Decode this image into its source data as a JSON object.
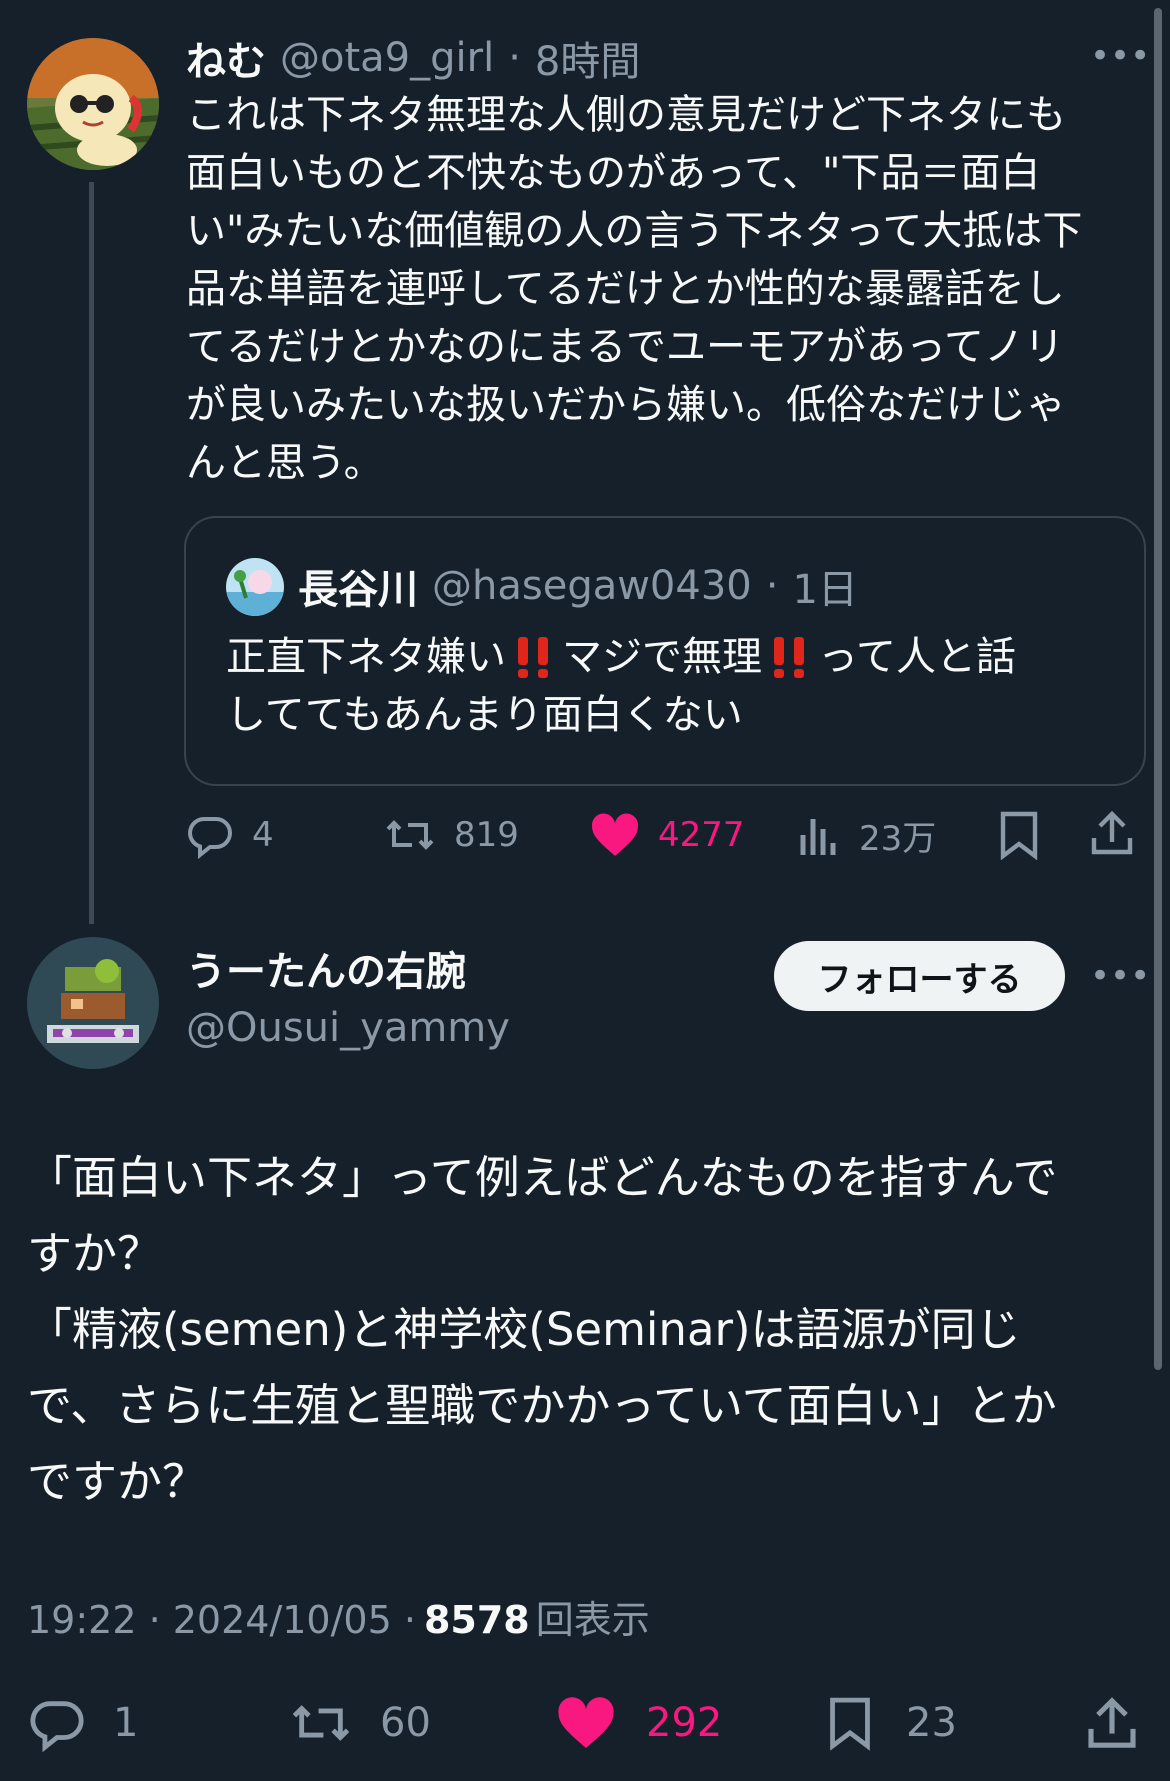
{
  "original_tweet": {
    "display_name": "ねむ",
    "handle": "@ota9_girl",
    "time": "8時間",
    "lines": [
      "これは下ネタ無理な人側の意見だけど下ネタにも",
      "面白いものと不快なものがあって、\"下品＝面白",
      "い\"みたいな価値観の人の言う下ネタって大抵は下",
      "品な単語を連呼してるだけとか性的な暴露話をし",
      "てるだけとかなのにまるでユーモアがあってノリ",
      "が良いみたいな扱いだから嫌い。低俗なだけじゃ",
      "んと思う。"
    ],
    "quoted": {
      "display_name": "長谷川",
      "handle": "@hasegaw0430",
      "time": "1日",
      "line1_a": "正直下ネタ嫌い",
      "line1_b": "マジで無理",
      "line1_c": "って人と話",
      "line2": "しててもあんまり面白くない"
    },
    "metrics": {
      "replies": "4",
      "retweets": "819",
      "likes": "4277",
      "views": "23万"
    }
  },
  "reply_tweet": {
    "display_name": "うーたんの右腕",
    "handle": "@Ousui_yammy",
    "follow_label": "フォローする",
    "lines": [
      "「面白い下ネタ」って例えばどんなものを指すんで",
      "すか？",
      "「精液(semen)と神学校(Seminar)は語源が同じ",
      "で、さらに生殖と聖職でかかっていて面白い」とか",
      "ですか？"
    ],
    "timestamp": "19:22 · 2024/10/05 · ",
    "view_count": "8578",
    "view_label": "回表示",
    "metrics": {
      "replies": "1",
      "retweets": "60",
      "likes": "292",
      "bookmarks": "23"
    }
  },
  "colors": {
    "background": "#15202b",
    "text": "#f7f9f9",
    "muted": "#8b98a5",
    "like": "#f91880",
    "border": "#38444d"
  },
  "icons": [
    "reply-icon",
    "retweet-icon",
    "heart-icon",
    "views-icon",
    "bookmark-icon",
    "share-icon",
    "more-icon",
    "double-exclamation-icon"
  ]
}
